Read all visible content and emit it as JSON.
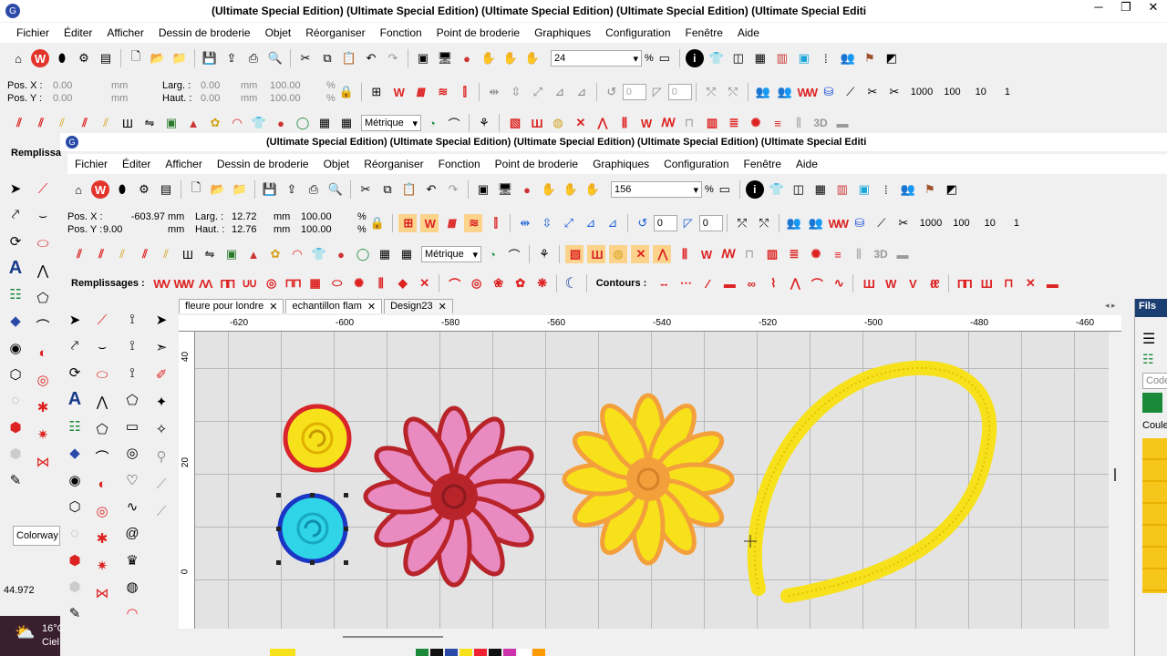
{
  "outer_window": {
    "title": "(Ultimate Special Edition) (Ultimate Special Edition) (Ultimate Special Edition) (Ultimate Special Edition) (Ultimate Special Editi",
    "menu": [
      "Fichier",
      "Éditer",
      "Afficher",
      "Dessin de broderie",
      "Objet",
      "Réorganiser",
      "Fonction",
      "Point de broderie",
      "Graphiques",
      "Configuration",
      "Fenêtre",
      "Aide"
    ],
    "zoom_value": "24",
    "zoom_unit": "%",
    "pos_x_label": "Pos. X :",
    "pos_x": "0.00",
    "pos_x_unit": "mm",
    "pos_y_label": "Pos. Y :",
    "pos_y": "0.00",
    "pos_y_unit": "mm",
    "width_label": "Larg. :",
    "width": "0.00",
    "width_unit": "mm",
    "height_label": "Haut. :",
    "height": "0.00",
    "height_unit": "mm",
    "scale_x": "100.00",
    "scale_y": "100.00",
    "scale_unit": "%",
    "units": "Métrique",
    "rotate": "0",
    "slant": "0",
    "counts": [
      "1000",
      "100",
      "10",
      "1"
    ],
    "side_label": "Remplissa",
    "colorway": "Colorway",
    "coords": "44.972"
  },
  "inner_window": {
    "title": "(Ultimate Special Edition) (Ultimate Special Edition) (Ultimate Special Edition) (Ultimate Special Edition) (Ultimate Special Editi",
    "menu": [
      "Fichier",
      "Éditer",
      "Afficher",
      "Dessin de broderie",
      "Objet",
      "Réorganiser",
      "Fonction",
      "Point de broderie",
      "Graphiques",
      "Configuration",
      "Fenêtre",
      "Aide"
    ],
    "zoom_value": "156",
    "zoom_unit": "%",
    "pos_x_label": "Pos. X :",
    "pos_x": "-603.97",
    "pos_x_unit": "mm",
    "pos_y_label": "Pos. Y :",
    "pos_y": "9.00",
    "pos_y_unit": "mm",
    "width_label": "Larg. :",
    "width": "12.72",
    "width_unit": "mm",
    "height_label": "Haut. :",
    "height": "12.76",
    "height_unit": "mm",
    "scale_x": "100.00",
    "scale_y": "100.00",
    "scale_unit": "%",
    "units": "Métrique",
    "rotate": "0",
    "slant": "0",
    "counts": [
      "1000",
      "100",
      "10",
      "1"
    ],
    "fills_label": "Remplissages :",
    "contours_label": "Contours :",
    "tabs": [
      {
        "label": "fleure pour londre",
        "close": "✕"
      },
      {
        "label": "echantillon flam",
        "close": "✕"
      },
      {
        "label": "Design23",
        "close": "✕"
      }
    ],
    "ruler_x": [
      "-620",
      "-600",
      "-580",
      "-560",
      "-540",
      "-520",
      "-500",
      "-480",
      "-460"
    ],
    "ruler_y": [
      "40",
      "20",
      "0"
    ],
    "right_panel": {
      "title": "Fils",
      "code": "Code",
      "color": "Coule"
    }
  },
  "taskbar": {
    "temp": "16°C",
    "weather": "Ciel"
  },
  "colors": {
    "accent_yellow": "#f7e11a",
    "pink": "#e98bc0",
    "red": "#b8242a",
    "orange": "#f3a03c",
    "cyan": "#2fd4e6",
    "blue": "#1b35c4"
  }
}
